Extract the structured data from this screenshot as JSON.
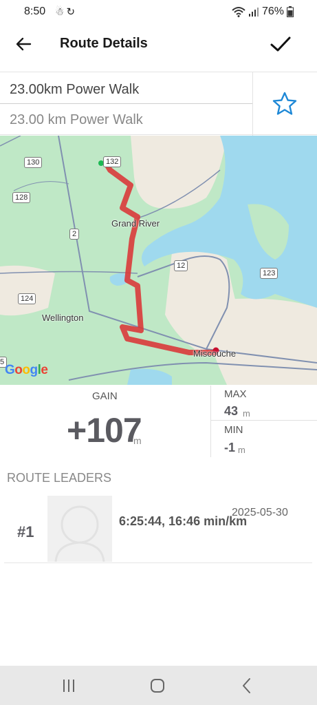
{
  "status_bar": {
    "time": "8:50",
    "left_icons": [
      "notification-icon",
      "sync-icon"
    ],
    "battery": "76%"
  },
  "app_bar": {
    "title": "Route Details",
    "back_icon": "arrow-left-icon",
    "confirm_icon": "checkmark-icon"
  },
  "route": {
    "name_display": "23.00km Power Walk",
    "name_input_value": "23.00 km Power Walk",
    "favorite_icon": "star-outline-icon",
    "accent_color": "#1e88d6"
  },
  "map": {
    "labels": {
      "grand_river": "Grand River",
      "wellington": "Wellington",
      "miscouche": "Miscouche"
    },
    "shields": {
      "r130": "130",
      "r132": "132",
      "r128": "128",
      "r2": "2",
      "r12": "12",
      "r123": "123",
      "r124": "124",
      "r5": "5"
    },
    "route_color": "#d93a3a",
    "start_color": "#1db954",
    "end_color": "#c8102e",
    "attribution": "Google"
  },
  "stats": {
    "gain_label": "GAIN",
    "gain_value": "+107",
    "gain_unit": "m",
    "max_label": "MAX",
    "max_value": "43",
    "max_unit": "m",
    "min_label": "MIN",
    "min_value": "-1",
    "min_unit": "m"
  },
  "leaders": {
    "heading": "ROUTE LEADERS",
    "rows": [
      {
        "rank": "#1",
        "time": "6:25:44, 16:46 min/km",
        "date": "2025-05-30",
        "avatar_icon": "user-placeholder-icon"
      }
    ]
  },
  "nav_bar": {
    "recents_icon": "recents-icon",
    "home_icon": "home-icon",
    "back_icon": "back-nav-icon"
  }
}
